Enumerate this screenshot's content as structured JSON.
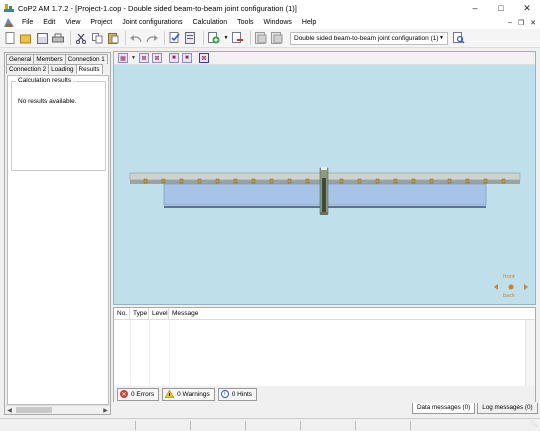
{
  "window": {
    "title": "CoP2 AM 1.7.2 - [Project-1.cop - Double sided beam-to-beam joint configuration (1)]",
    "controls": [
      "minimize",
      "maximize",
      "close"
    ]
  },
  "menu": {
    "items": [
      "File",
      "Edit",
      "View",
      "Project",
      "Joint configurations",
      "Calculation",
      "Tools",
      "Windows",
      "Help"
    ]
  },
  "toolbar": {
    "configuration_select": "Double sided beam-to-beam joint configuration (1)"
  },
  "left_panel": {
    "tabs_row1": [
      "General",
      "Members",
      "Connection 1"
    ],
    "tabs_row2": [
      "Connection 2",
      "Loading",
      "Results"
    ],
    "active_tab": "Results",
    "group_title": "Calculation results",
    "group_message": "No results available."
  },
  "viewport": {
    "background_color": "#bfe0ea",
    "nav_labels": [
      "front",
      "back"
    ]
  },
  "messages": {
    "columns": [
      "No.",
      "Type",
      "Level",
      "Message"
    ],
    "errors_label": "0 Errors",
    "warnings_label": "0 Warnings",
    "hints_label": "0 Hints"
  },
  "bottom_tabs": {
    "data_messages": "Data messages (0)",
    "log_messages": "Log messages (0)"
  }
}
